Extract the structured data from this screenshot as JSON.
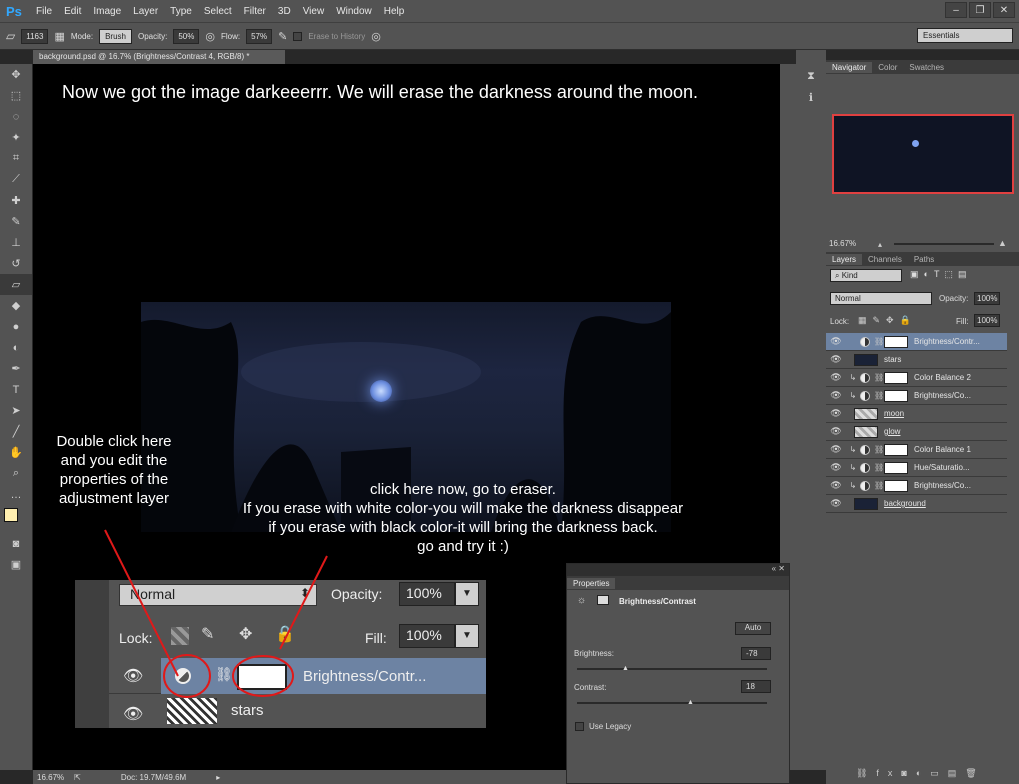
{
  "menubar": {
    "logo": "Ps",
    "items": [
      "File",
      "Edit",
      "Image",
      "Layer",
      "Type",
      "Select",
      "Filter",
      "3D",
      "View",
      "Window",
      "Help"
    ]
  },
  "options": {
    "brush_size": "1163",
    "mode_label": "Mode:",
    "mode_value": "Brush",
    "opacity_label": "Opacity:",
    "opacity_value": "50%",
    "flow_label": "Flow:",
    "flow_value": "57%",
    "erase_history": "Erase to History",
    "workspace": "Essentials"
  },
  "document": {
    "tab": "background.psd @ 16.7% (Brightness/Contrast 4, RGB/8) *"
  },
  "canvas": {
    "heading": "Now we got the image darkeeerrr. We will erase the darkness around the moon.",
    "note_left": [
      "Double click here",
      "and you edit the",
      "properties of the",
      "adjustment layer"
    ],
    "note_center": [
      "click here now, go to eraser.",
      "If you erase with white color-you will make the darkness disappear",
      "if you erase with black color-it will bring the darkness back.",
      "go and try it :)"
    ]
  },
  "zoom_panel": {
    "blend": "Normal",
    "opacity_label": "Opacity:",
    "opacity_value": "100%",
    "lock_label": "Lock:",
    "fill_label": "Fill:",
    "fill_value": "100%",
    "layer1": "Brightness/Contr...",
    "layer2": "stars"
  },
  "properties": {
    "tab": "Properties",
    "title": "Brightness/Contrast",
    "auto": "Auto",
    "brightness_label": "Brightness:",
    "brightness_value": "-78",
    "contrast_label": "Contrast:",
    "contrast_value": "18",
    "legacy": "Use Legacy"
  },
  "navigator": {
    "tabs": [
      "Navigator",
      "Color",
      "Swatches"
    ],
    "zoom": "16.67%"
  },
  "layers_panel": {
    "tabs": [
      "Layers",
      "Channels",
      "Paths"
    ],
    "kind": "Kind",
    "blend": "Normal",
    "opacity_label": "Opacity:",
    "opacity_value": "100%",
    "lock_label": "Lock:",
    "fill_label": "Fill:",
    "fill_value": "100%",
    "layers": [
      {
        "name": "Brightness/Contr...",
        "type": "adj-top",
        "selected": true
      },
      {
        "name": "stars",
        "type": "dark"
      },
      {
        "name": "Color Balance 2",
        "type": "adj"
      },
      {
        "name": "Brightness/Co...",
        "type": "adj"
      },
      {
        "name": "moon",
        "type": "check"
      },
      {
        "name": "glow",
        "type": "check"
      },
      {
        "name": "Color Balance 1",
        "type": "adj"
      },
      {
        "name": "Hue/Saturatio...",
        "type": "adj"
      },
      {
        "name": "Brightness/Co...",
        "type": "adj"
      },
      {
        "name": "background",
        "type": "dark"
      }
    ]
  },
  "status": {
    "zoom": "16.67%",
    "doc": "Doc: 19.7M/49.6M"
  },
  "colors": {
    "accent": "#31a8ff",
    "selected_layer": "#6d83a3",
    "annotation_red": "#e01919"
  }
}
